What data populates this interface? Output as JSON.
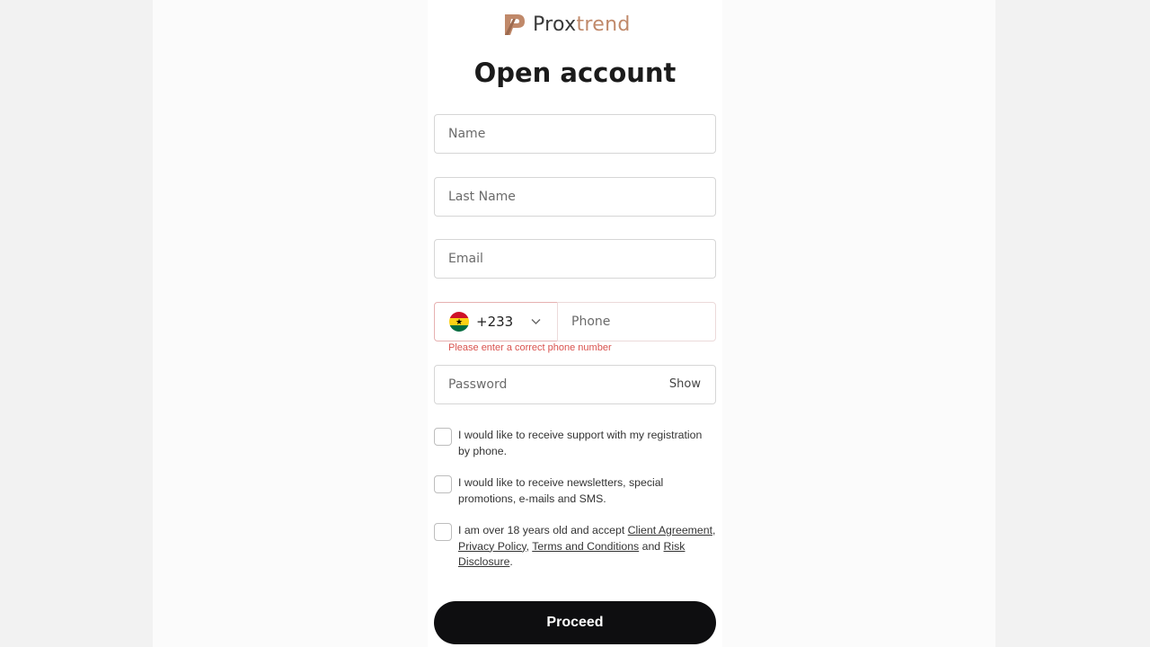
{
  "brand": {
    "logo_text_prefix": "Prox",
    "logo_text_suffix": "trend",
    "accent_color": "#c0896a"
  },
  "page": {
    "title": "Open account"
  },
  "form": {
    "name_placeholder": "Name",
    "last_name_placeholder": "Last Name",
    "email_placeholder": "Email",
    "country_code": "+233",
    "country_flag": "ghana-flag-icon",
    "phone_placeholder": "Phone",
    "phone_error": "Please enter a correct phone number",
    "password_placeholder": "Password",
    "show_label": "Show",
    "checkbox_support": "I would like to receive support with my registration by phone.",
    "checkbox_newsletter": "I would like to receive newsletters, special promotions, e-mails and SMS.",
    "agreement_prefix": "I am over 18 years old and accept ",
    "agreement_link_client": "Client Agreement",
    "agreement_sep1": ", ",
    "agreement_link_privacy": "Privacy Policy",
    "agreement_sep2": ", ",
    "agreement_link_terms": "Terms and Conditions",
    "agreement_and": " and ",
    "agreement_link_risk": "Risk Disclosure",
    "agreement_end": ".",
    "proceed_label": "Proceed",
    "error_color": "#d9534f"
  }
}
